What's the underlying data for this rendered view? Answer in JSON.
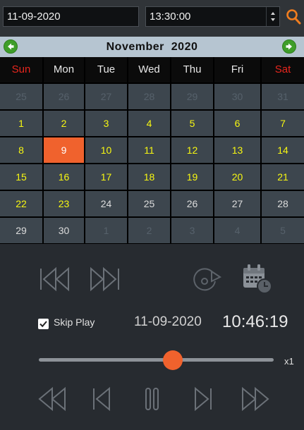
{
  "toolbar": {
    "date_value": "11-09-2020",
    "time_value": "13:30:00",
    "search_icon": "search-icon",
    "accent": "#f0622d"
  },
  "calendar": {
    "month_title": "November  2020",
    "prev_icon": "green-left-arrow-icon",
    "next_icon": "green-right-arrow-icon",
    "weekdays": [
      "Sun",
      "Mon",
      "Tue",
      "Wed",
      "Thu",
      "Fri",
      "Sat"
    ],
    "weekday_colors": {
      "weekend": "#e8261d",
      "weekday": "#e8e8e8"
    },
    "weeks": [
      [
        {
          "d": "25",
          "s": "out"
        },
        {
          "d": "26",
          "s": "out"
        },
        {
          "d": "27",
          "s": "out"
        },
        {
          "d": "28",
          "s": "out"
        },
        {
          "d": "29",
          "s": "out"
        },
        {
          "d": "30",
          "s": "out"
        },
        {
          "d": "31",
          "s": "out"
        }
      ],
      [
        {
          "d": "1",
          "s": "hl"
        },
        {
          "d": "2",
          "s": "hl"
        },
        {
          "d": "3",
          "s": "hl"
        },
        {
          "d": "4",
          "s": "hl"
        },
        {
          "d": "5",
          "s": "hl"
        },
        {
          "d": "6",
          "s": "hl"
        },
        {
          "d": "7",
          "s": "hl"
        }
      ],
      [
        {
          "d": "8",
          "s": "hl"
        },
        {
          "d": "9",
          "s": "sel"
        },
        {
          "d": "10",
          "s": "hl"
        },
        {
          "d": "11",
          "s": "hl"
        },
        {
          "d": "12",
          "s": "hl"
        },
        {
          "d": "13",
          "s": "hl"
        },
        {
          "d": "14",
          "s": "hl"
        }
      ],
      [
        {
          "d": "15",
          "s": "hl"
        },
        {
          "d": "16",
          "s": "hl"
        },
        {
          "d": "17",
          "s": "hl"
        },
        {
          "d": "18",
          "s": "hl"
        },
        {
          "d": "19",
          "s": "hl"
        },
        {
          "d": "20",
          "s": "hl"
        },
        {
          "d": "21",
          "s": "hl"
        }
      ],
      [
        {
          "d": "22",
          "s": "hl"
        },
        {
          "d": "23",
          "s": "hl"
        },
        {
          "d": "24",
          "s": "nm"
        },
        {
          "d": "25",
          "s": "nm"
        },
        {
          "d": "26",
          "s": "nm"
        },
        {
          "d": "27",
          "s": "nm"
        },
        {
          "d": "28",
          "s": "nm"
        }
      ],
      [
        {
          "d": "29",
          "s": "nm"
        },
        {
          "d": "30",
          "s": "nm"
        },
        {
          "d": "1",
          "s": "out"
        },
        {
          "d": "2",
          "s": "out"
        },
        {
          "d": "3",
          "s": "out"
        },
        {
          "d": "4",
          "s": "out"
        },
        {
          "d": "5",
          "s": "out"
        }
      ]
    ],
    "colors": {
      "recorded": "#f7f711",
      "selected": "#f0622d",
      "cell": "#3d464e"
    }
  },
  "playback": {
    "icons": [
      "skip-to-start-icon",
      "skip-to-end-icon",
      "snapshot-disc-icon",
      "calendar-clock-icon"
    ],
    "skip_play_label": "Skip Play",
    "skip_play_checked": true,
    "current_date": "11-09-2020",
    "current_time": "10:46:19",
    "progress_fraction": 0.57,
    "speed_label": "x1",
    "control_icons": [
      "rewind-icon",
      "previous-frame-icon",
      "pause-icon",
      "next-frame-icon",
      "fast-forward-icon"
    ]
  }
}
